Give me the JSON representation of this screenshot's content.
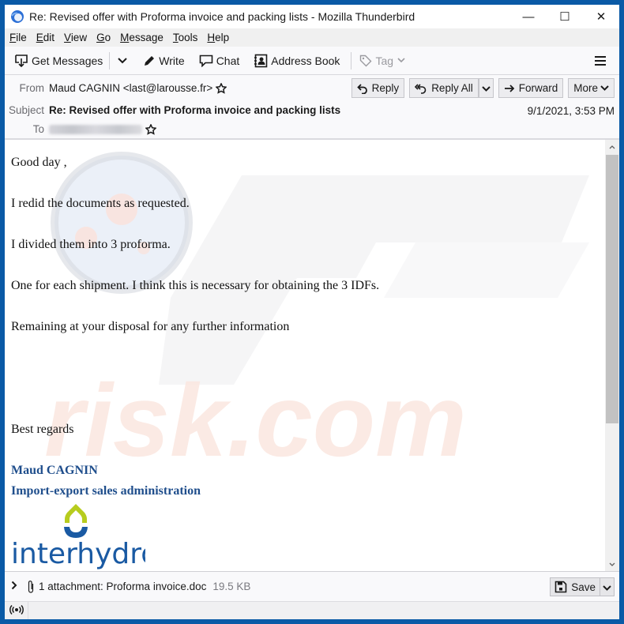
{
  "window": {
    "title": "Re: Revised offer with Proforma invoice and packing lists - Mozilla Thunderbird",
    "controls": {
      "minimize": "—",
      "maximize": "☐",
      "close": "✕"
    }
  },
  "menubar": {
    "items": [
      {
        "label": "File",
        "accel": "F",
        "rest": "ile"
      },
      {
        "label": "Edit",
        "accel": "E",
        "rest": "dit"
      },
      {
        "label": "View",
        "accel": "V",
        "rest": "iew"
      },
      {
        "label": "Go",
        "accel": "G",
        "rest": "o"
      },
      {
        "label": "Message",
        "accel": "M",
        "rest": "essage"
      },
      {
        "label": "Tools",
        "accel": "T",
        "rest": "ools"
      },
      {
        "label": "Help",
        "accel": "H",
        "rest": "elp"
      }
    ]
  },
  "toolbar": {
    "get_messages": "Get Messages",
    "write": "Write",
    "chat": "Chat",
    "address_book": "Address Book",
    "tag": "Tag"
  },
  "header": {
    "from_label": "From",
    "from_value": "Maud CAGNIN <last@larousse.fr>",
    "subject_label": "Subject",
    "subject_value": "Re: Revised offer with Proforma invoice and packing lists",
    "to_label": "To",
    "date": "9/1/2021, 3:53 PM",
    "buttons": {
      "reply": "Reply",
      "reply_all": "Reply All",
      "forward": "Forward",
      "more": "More"
    }
  },
  "message": {
    "paragraphs": [
      "Good day ,",
      "I redid the documents as requested.",
      "I divided them into 3 proforma.",
      "One for each shipment. I think this is necessary for obtaining the 3 IDFs.",
      "Remaining at your disposal for any further information",
      "Best regards"
    ],
    "signature": {
      "name": "Maud CAGNIN",
      "role": "Import-export sales administration",
      "logo_text": "interhydro"
    },
    "colors": {
      "signature": "#1f4e8c",
      "logo_blue": "#1a5aa3",
      "logo_green": "#b7cc1e"
    }
  },
  "attachment": {
    "summary": "1 attachment: Proforma invoice.doc",
    "size": "19.5 KB",
    "save_label": "Save"
  },
  "colors": {
    "window_border": "#0a5aa6"
  }
}
